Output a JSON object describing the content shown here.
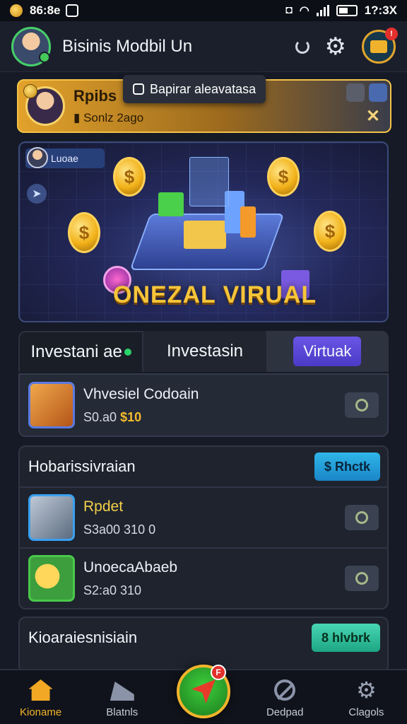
{
  "status_bar": {
    "time": "86:8e",
    "battery_text": "1?:3X"
  },
  "header": {
    "title": "Bisinis Modbil Un"
  },
  "promo": {
    "name": "Rpibs",
    "sub": "Sonlz 2ago",
    "tooltip": "Bapirar aleavatasa",
    "close": "✕"
  },
  "hero": {
    "chip_label": "Luoae",
    "title": "ONEZAL VIRUAL",
    "coin_symbol": "$"
  },
  "tabs": [
    {
      "label": "Investani ae"
    },
    {
      "label": "Investasin"
    },
    {
      "label": "Virtuak"
    }
  ],
  "featured_item": {
    "title": "Vhvesiel Codoain",
    "meta": "S0.a0",
    "meta_accent": "$10"
  },
  "section1": {
    "title": "Hobarissivraian",
    "pill": "$ Rhctk",
    "items": [
      {
        "title": "Rpdet",
        "meta": "S3a00 310 0"
      },
      {
        "title": "UnoecaAbaeb",
        "meta": "S2:a0 310"
      }
    ]
  },
  "section2": {
    "title": "Kioaraiesnisiain",
    "pill": "8 hlvbrk"
  },
  "bottom_nav": [
    {
      "label": "Kioname"
    },
    {
      "label": "Blatnls"
    },
    {
      "label": "Dedpad"
    },
    {
      "label": "Clagols"
    }
  ],
  "fab_badge": "F",
  "wallet_badge": "!",
  "colors": {
    "accent": "#f2b42c",
    "primary_purple": "#5a47d8",
    "background": "#161a26"
  }
}
